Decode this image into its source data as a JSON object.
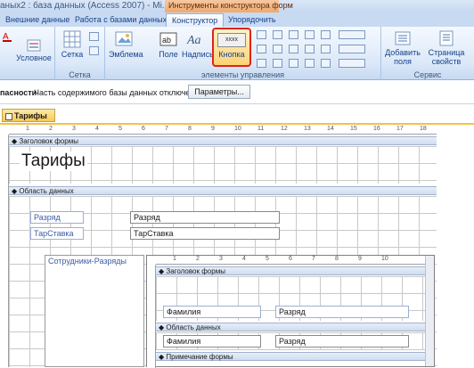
{
  "window": {
    "title": "аных2 : база данных (Access 2007) - Mi...",
    "context_group": "Инструменты конструктора форм"
  },
  "tabs": [
    "Внешние данные",
    "Работа с базами данных",
    "Конструктор",
    "Упорядочить"
  ],
  "ribbon": {
    "groups": {
      "grid": "Сетка",
      "controls": "элементы управления",
      "service": "Сервис"
    },
    "buttons": {
      "conditional": "Условное",
      "grid": "Сетка",
      "logo": "Эмблема",
      "field": "Поле",
      "label": "Надпись",
      "button": "Кнопка",
      "button_icon_text": "xxxx",
      "add_fields": "Добавить поля",
      "property_sheet": "Страница свойств"
    }
  },
  "message_bar": {
    "warning": "пасности",
    "text": "Часть содержимого базы данных отключено",
    "options_button": "Параметры..."
  },
  "document": {
    "tab": "Тарифы",
    "ruler_ticks": [
      "1",
      "2",
      "3",
      "4",
      "5",
      "6",
      "7",
      "8",
      "9",
      "10",
      "11",
      "12",
      "13",
      "14",
      "15",
      "16",
      "17",
      "18"
    ],
    "sections": {
      "form_header": "Заголовок формы",
      "detail": "Область данных"
    },
    "form_title": "Тарифы",
    "controls": [
      {
        "label": "Разряд",
        "field": "Разряд"
      },
      {
        "label": "ТарСтавка",
        "field": "ТарСтавка"
      }
    ],
    "subform_label": "Сотрудники-Разряды",
    "subform": {
      "ruler_ticks": [
        "1",
        "2",
        "3",
        "4",
        "5",
        "6",
        "7",
        "8",
        "9",
        "10"
      ],
      "sections": {
        "form_header": "Заголовок формы",
        "detail": "Область данных",
        "form_footer": "Примечание формы"
      },
      "header_labels": [
        "Фамилия",
        "Разряд"
      ],
      "detail_fields": [
        "Фамилия",
        "Разряд"
      ]
    }
  }
}
